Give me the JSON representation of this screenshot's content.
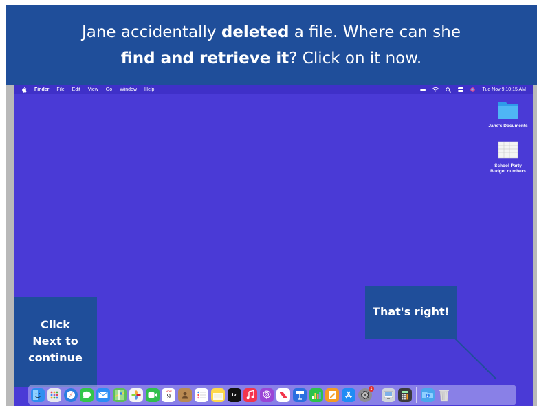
{
  "banner": {
    "line1_a": "Jane accidentally ",
    "line1_b": "deleted",
    "line1_c": " a file. Where can she",
    "line2_a": "find and retrieve it",
    "line2_b": "? Click on it now."
  },
  "menubar": {
    "apple_icon": "apple-logo",
    "items": [
      "Finder",
      "File",
      "Edit",
      "View",
      "Go",
      "Window",
      "Help"
    ],
    "status_icons": [
      "battery-icon",
      "wifi-icon",
      "spotlight-icon",
      "control-center-icon",
      "siri-icon"
    ],
    "clock": "Tue Nov 9  10:15 AM"
  },
  "desktop_icons": [
    {
      "label": "Jane's Documents",
      "icon": "folder-icon"
    },
    {
      "label_line1": "School Party",
      "label_line2": "Budget.numbers",
      "icon": "document-icon"
    }
  ],
  "prompt_left": {
    "line1": "Click",
    "line2": "Next to",
    "line3": "continue"
  },
  "prompt_right": {
    "text": "That's right!"
  },
  "dock": {
    "calendar_month": "NOV",
    "calendar_day": "9",
    "system_prefs_badge": "1",
    "tv_label": "tv",
    "apps": [
      {
        "name": "finder",
        "color": "#2f8ef0"
      },
      {
        "name": "launchpad",
        "color": "#e8e8ef"
      },
      {
        "name": "safari",
        "color": "#2a7de1"
      },
      {
        "name": "messages",
        "color": "#33c64a"
      },
      {
        "name": "mail",
        "color": "#2c8df5"
      },
      {
        "name": "maps",
        "color": "#5cbf5a"
      },
      {
        "name": "photos",
        "color": "#f5f5f5"
      },
      {
        "name": "facetime",
        "color": "#2fbf4d"
      },
      {
        "name": "calendar",
        "color": "#ffffff"
      },
      {
        "name": "contacts",
        "color": "#b98a52"
      },
      {
        "name": "reminders",
        "color": "#ffffff"
      },
      {
        "name": "notes",
        "color": "#ffd84a"
      },
      {
        "name": "tv",
        "color": "#111111"
      },
      {
        "name": "music",
        "color": "#f3344d"
      },
      {
        "name": "podcasts",
        "color": "#9a45d6"
      },
      {
        "name": "news",
        "color": "#ffffff"
      },
      {
        "name": "keynote",
        "color": "#2b6fe0"
      },
      {
        "name": "numbers",
        "color": "#2cc24c"
      },
      {
        "name": "pages",
        "color": "#f59b22"
      },
      {
        "name": "app-store",
        "color": "#1f8cf5"
      },
      {
        "name": "system-preferences",
        "color": "#8d8d93"
      }
    ],
    "right_apps": [
      {
        "name": "preview",
        "color": "#cfd4dc"
      },
      {
        "name": "calculator",
        "color": "#3a3a3c"
      }
    ],
    "trash": {
      "name": "trash"
    },
    "downloads": {
      "name": "downloads-folder",
      "color": "#4aa6ec"
    }
  }
}
